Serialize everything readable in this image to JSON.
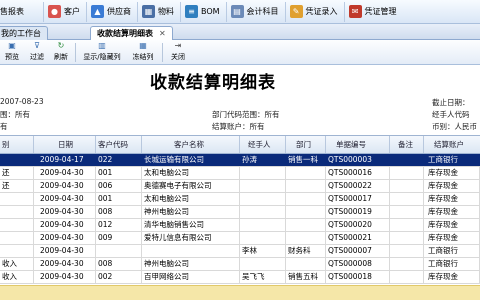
{
  "toolbar": {
    "items": [
      {
        "label": "销售报表",
        "icon": "report-icon"
      },
      {
        "label": "客户",
        "icon": "customer-icon"
      },
      {
        "label": "供应商",
        "icon": "supplier-icon"
      },
      {
        "label": "物料",
        "icon": "material-icon"
      },
      {
        "label": "BOM",
        "icon": "bom-icon"
      },
      {
        "label": "会计科目",
        "icon": "account-icon"
      },
      {
        "label": "凭证录入",
        "icon": "voucher-entry-icon"
      },
      {
        "label": "凭证管理",
        "icon": "voucher-manage-icon"
      }
    ]
  },
  "tabs": {
    "workbench": "我的工作台",
    "active": "收款结算明细表"
  },
  "actions": {
    "preview": "预览",
    "filter": "过滤",
    "refresh": "刷新",
    "show_hide_columns": "显示/隐藏列",
    "freeze_columns": "冻结列",
    "close": "关闭"
  },
  "report": {
    "title": "收款结算明细表",
    "date": "2007-08-23",
    "customer_range": "围：所有",
    "dept_range": "部门代码范围：所有",
    "settle_account": "结算账户：所有",
    "cutoff_date": "截止日期：",
    "handler_code": "经手人代码",
    "currency": "币别：人民币",
    "row3_left": "有"
  },
  "table": {
    "headers": [
      "别",
      "日期",
      "客户代码",
      "客户名称",
      "经手人",
      "部门",
      "单据编号",
      "备注",
      "结算账户"
    ],
    "rows": [
      {
        "type": "",
        "date": "2009-04-17",
        "code": "022",
        "name": "长城运输有限公司",
        "handler": "孙涛",
        "dept": "销售一科",
        "doc": "QTS000003",
        "note": "",
        "account": "工商银行",
        "selected": true
      },
      {
        "type": "还",
        "date": "2009-04-30",
        "code": "001",
        "name": "太和电脑公司",
        "handler": "",
        "dept": "",
        "doc": "QTS000016",
        "note": "",
        "account": "库存现金",
        "selected": false
      },
      {
        "type": "还",
        "date": "2009-04-30",
        "code": "006",
        "name": "奥德赛电子有限公司",
        "handler": "",
        "dept": "",
        "doc": "QTS000022",
        "note": "",
        "account": "库存现金",
        "selected": false
      },
      {
        "type": "",
        "date": "2009-04-30",
        "code": "001",
        "name": "太和电脑公司",
        "handler": "",
        "dept": "",
        "doc": "QTS000017",
        "note": "",
        "account": "库存现金",
        "selected": false
      },
      {
        "type": "",
        "date": "2009-04-30",
        "code": "008",
        "name": "神州电脑公司",
        "handler": "",
        "dept": "",
        "doc": "QTS000019",
        "note": "",
        "account": "库存现金",
        "selected": false
      },
      {
        "type": "",
        "date": "2009-04-30",
        "code": "012",
        "name": "清华电脑销售公司",
        "handler": "",
        "dept": "",
        "doc": "QTS000020",
        "note": "",
        "account": "库存现金",
        "selected": false
      },
      {
        "type": "",
        "date": "2009-04-30",
        "code": "009",
        "name": "爱特儿信息有限公司",
        "handler": "",
        "dept": "",
        "doc": "QTS000021",
        "note": "",
        "account": "库存现金",
        "selected": false
      },
      {
        "type": "",
        "date": "2009-04-30",
        "code": "",
        "name": "",
        "handler": "李林",
        "dept": "财务科",
        "doc": "QTS000007",
        "note": "",
        "account": "工商银行",
        "selected": false
      },
      {
        "type": "收入",
        "date": "2009-04-30",
        "code": "008",
        "name": "神州电脑公司",
        "handler": "",
        "dept": "",
        "doc": "QTS000008",
        "note": "",
        "account": "工商银行",
        "selected": false
      },
      {
        "type": "收入",
        "date": "2009-04-30",
        "code": "002",
        "name": "百甲网络公司",
        "handler": "吴飞飞",
        "dept": "销售五科",
        "doc": "QTS000018",
        "note": "",
        "account": "库存现金",
        "selected": false
      }
    ]
  },
  "colors": {
    "selected_row": "#0a2a7a",
    "header_gradient": "#dbe6f3",
    "footer_bar": "#f5e7a8"
  }
}
